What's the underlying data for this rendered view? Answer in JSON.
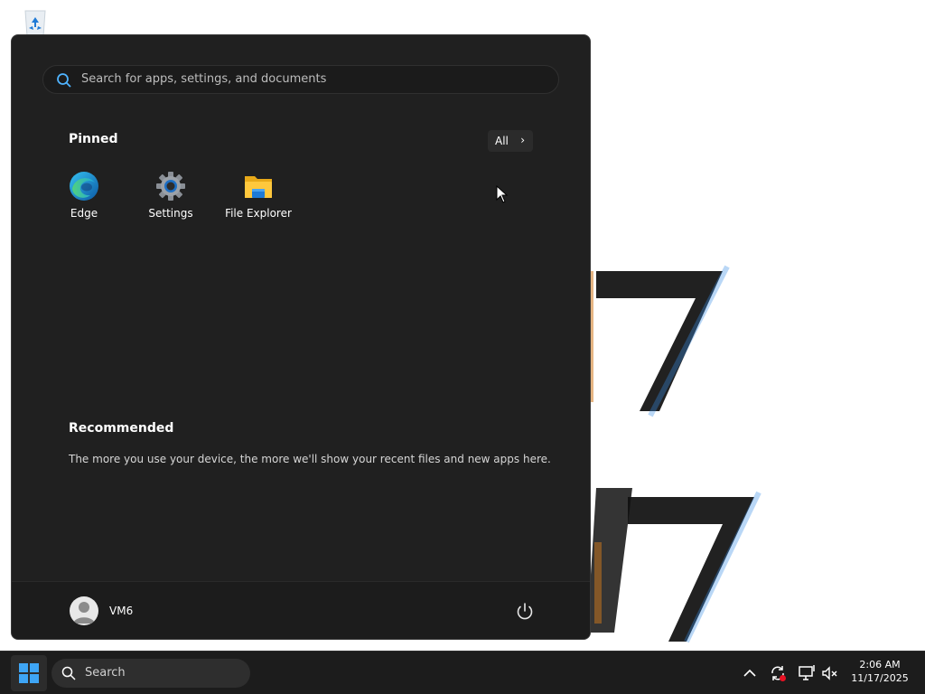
{
  "start_menu": {
    "search_placeholder": "Search for apps, settings, and documents",
    "pinned_title": "Pinned",
    "all_label": "All",
    "pinned_apps": [
      {
        "label": "Edge",
        "icon": "edge-icon"
      },
      {
        "label": "Settings",
        "icon": "settings-gear-icon"
      },
      {
        "label": "File Explorer",
        "icon": "folder-icon"
      }
    ],
    "recommended_title": "Recommended",
    "recommended_text": "The more you use your device, the more we'll show your recent files and new apps here.",
    "user_name": "VM6"
  },
  "taskbar": {
    "search_label": "Search",
    "time": "2:06 AM",
    "date": "11/17/2025"
  },
  "colors": {
    "menu_bg": "#202020",
    "taskbar_bg": "#1c1c1c",
    "accent": "#0078d4"
  }
}
